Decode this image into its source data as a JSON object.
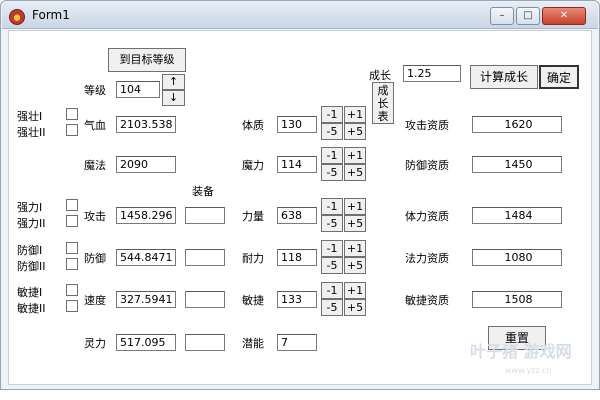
{
  "window": {
    "title": "Form1",
    "minimize": "–",
    "maximize": "□",
    "close": "✕"
  },
  "level": {
    "target_button": "到目标等级",
    "label": "等级",
    "value": "104",
    "up": "↑",
    "down": "↓"
  },
  "growth": {
    "label": "成长",
    "value": "1.25",
    "table_button": "成长表",
    "calc_button": "计算成长",
    "confirm_button": "确定"
  },
  "buffs": {
    "strong1": "强壮I",
    "strong2": "强壮II",
    "power1": "强力I",
    "power2": "强力II",
    "defend1": "防御I",
    "defend2": "防御II",
    "agile1": "敏捷I",
    "agile2": "敏捷II"
  },
  "stats": {
    "equip_header": "装备",
    "hp": {
      "label": "气血",
      "value": "2103.538"
    },
    "mp": {
      "label": "魔法",
      "value": "2090"
    },
    "atk": {
      "label": "攻击",
      "value": "1458.296",
      "equip": ""
    },
    "def": {
      "label": "防御",
      "value": "544.8471",
      "equip": ""
    },
    "spd": {
      "label": "速度",
      "value": "327.5941",
      "equip": ""
    },
    "spirit": {
      "label": "灵力",
      "value": "517.095",
      "equip": ""
    }
  },
  "attributes": {
    "dec1": "-1",
    "inc1": "+1",
    "dec5": "-5",
    "inc5": "+5",
    "con": {
      "label": "体质",
      "value": "130"
    },
    "mag": {
      "label": "魔力",
      "value": "114"
    },
    "str": {
      "label": "力量",
      "value": "638"
    },
    "end": {
      "label": "耐力",
      "value": "118"
    },
    "agi": {
      "label": "敏捷",
      "value": "133"
    },
    "potential": {
      "label": "潜能",
      "value": "7"
    }
  },
  "aptitudes": {
    "attack": {
      "label": "攻击资质",
      "value": "1620"
    },
    "defense": {
      "label": "防御资质",
      "value": "1450"
    },
    "stamina": {
      "label": "体力资质",
      "value": "1484"
    },
    "magic": {
      "label": "法力资质",
      "value": "1080"
    },
    "agility": {
      "label": "敏捷资质",
      "value": "1508"
    }
  },
  "reset_button": "重置",
  "watermark": {
    "main": "叶子猪 游戏网",
    "sub": "www.yzz.cn"
  }
}
